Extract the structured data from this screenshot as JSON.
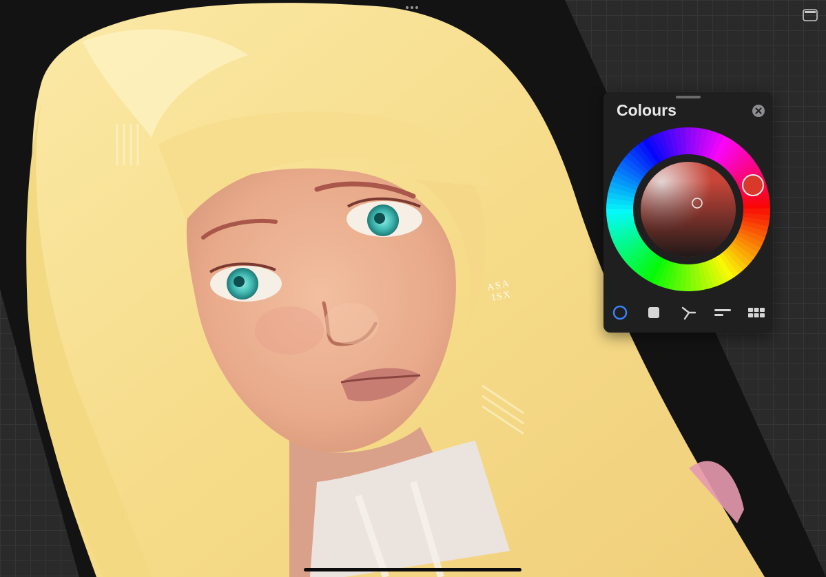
{
  "colours_panel": {
    "title": "Colours",
    "tabs": [
      {
        "name": "disc",
        "icon": "colour-disc-icon",
        "active": true
      },
      {
        "name": "classic",
        "icon": "square-icon",
        "active": false
      },
      {
        "name": "harmony",
        "icon": "harmony-icon",
        "active": false
      },
      {
        "name": "value",
        "icon": "sliders-icon",
        "active": false
      },
      {
        "name": "palettes",
        "icon": "grid-icon",
        "active": false
      }
    ]
  },
  "artwork": {
    "signature": [
      "ASA",
      "ISX"
    ]
  },
  "colors": {
    "accent": "#3b82f6",
    "panel_bg": "#1f1f20",
    "canvas_bg": "#2a2a2b",
    "hue_selected": "#d8392a"
  }
}
